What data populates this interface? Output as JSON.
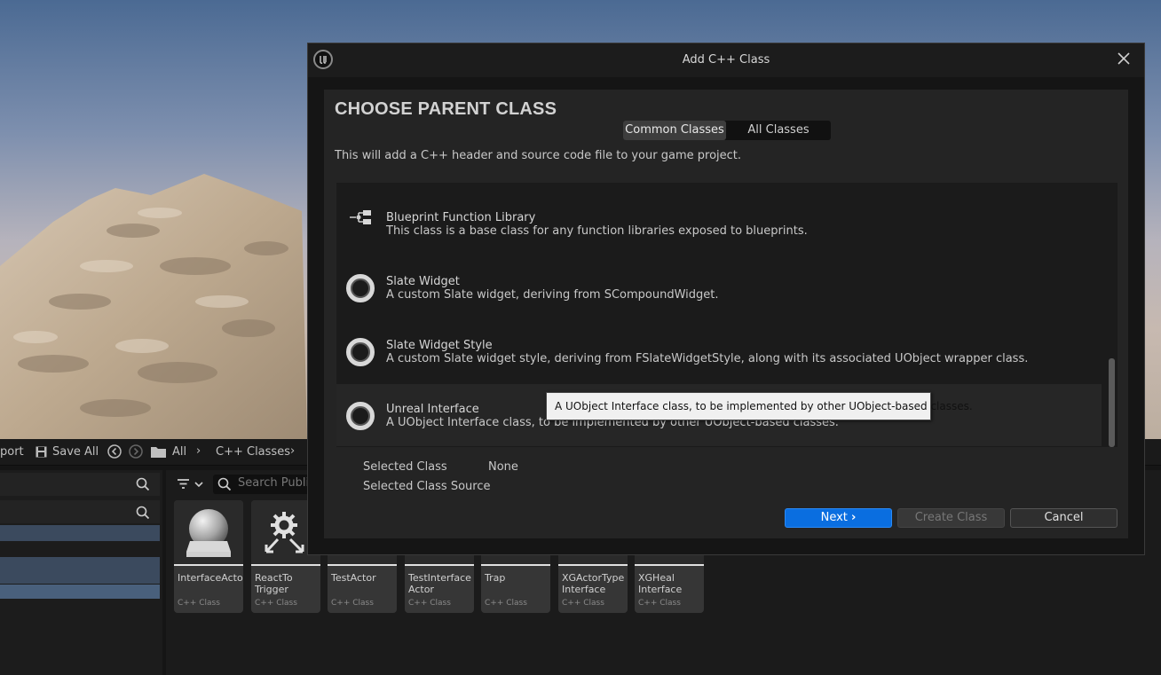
{
  "dialog": {
    "title": "Add C++ Class",
    "heading": "CHOOSE PARENT CLASS",
    "tabs": [
      {
        "label": "Common Classes",
        "active": true
      },
      {
        "label": "All Classes",
        "active": false
      }
    ],
    "description": "This will add a C++ header and source code file to your game project.",
    "classes": [
      {
        "name": "Blueprint Function Library",
        "description": "This class is a base class for any function libraries exposed to blueprints.",
        "icon": "blueprint-library-icon"
      },
      {
        "name": "Slate Widget",
        "description": "A custom Slate widget, deriving from SCompoundWidget.",
        "icon": "class-ring-icon"
      },
      {
        "name": "Slate Widget Style",
        "description": "A custom Slate widget style, deriving from FSlateWidgetStyle, along with its associated UObject wrapper class.",
        "icon": "class-ring-icon"
      },
      {
        "name": "Unreal Interface",
        "description": "A UObject Interface class, to be implemented by other UObject-based classes.",
        "icon": "class-ring-icon",
        "hovered": true
      }
    ],
    "tooltip": "A UObject Interface class, to be implemented by other UObject-based classes.",
    "selected_class_label": "Selected Class",
    "selected_class_value": "None",
    "selected_source_label": "Selected Class Source",
    "buttons": {
      "next": "Next",
      "create": "Create Class",
      "cancel": "Cancel"
    },
    "colors": {
      "accent": "#0a6ee0",
      "panel": "#242424",
      "list": "#1b1b1b"
    }
  },
  "content_browser": {
    "toolbar": {
      "import_fragment": "port",
      "save_all": "Save All",
      "breadcrumb": [
        "All",
        "C++ Classes"
      ]
    },
    "search_placeholder": "Search Publi",
    "assets": [
      {
        "name": "InterfaceActor",
        "type": "C++ Class"
      },
      {
        "name": "ReactTo Trigger",
        "type": "C++ Class"
      },
      {
        "name": "TestActor",
        "type": "C++ Class"
      },
      {
        "name": "TestInterface Actor",
        "type": "C++ Class"
      },
      {
        "name": "Trap",
        "type": "C++ Class"
      },
      {
        "name": "XGActorType Interface",
        "type": "C++ Class"
      },
      {
        "name": "XGHeal Interface",
        "type": "C++ Class"
      }
    ]
  }
}
